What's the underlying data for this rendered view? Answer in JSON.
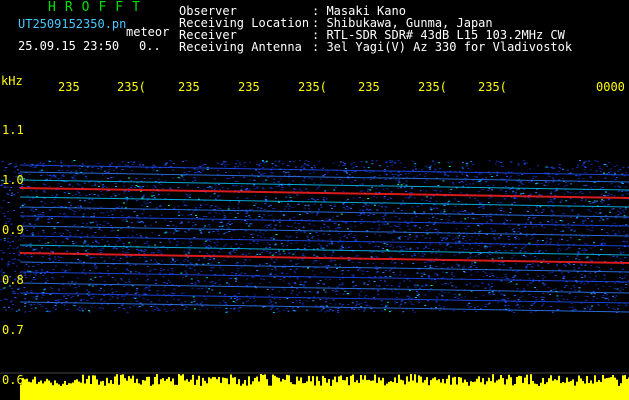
{
  "header": {
    "brand": "HROFFT",
    "filename": "UT2509152350.pn",
    "mode": "meteor",
    "datetime": "25.09.15 23:50",
    "count": "0..",
    "fields": [
      {
        "label": "Observer",
        "value": ": Masaki Kano"
      },
      {
        "label": "Receiving Location",
        "value": ": Shibukawa, Gunma, Japan"
      },
      {
        "label": "Receiver",
        "value": ": RTL-SDR SDR# 43dB L15 103.2MHz CW"
      },
      {
        "label": "Receiving Antenna",
        "value": ": 3el Yagi(V) Az 330 for Vladivostok"
      }
    ]
  },
  "y_axis": {
    "unit": "kHz",
    "ticks": [
      "1.1",
      "1.0",
      "0.9",
      "0.8",
      "0.7",
      "0.6"
    ]
  },
  "time_ticks": [
    "235",
    "235(",
    "235",
    "235",
    "235(",
    "235",
    "235(",
    "235(",
    "0000"
  ],
  "colors": {
    "background": "#000000",
    "axis_text": "#ffff00",
    "header_text": "#ffffff",
    "brand": "#00e000",
    "noise": "#0a2aa0",
    "signal_strong": "#ff2020",
    "bottom_bar": "#ffff00"
  }
}
